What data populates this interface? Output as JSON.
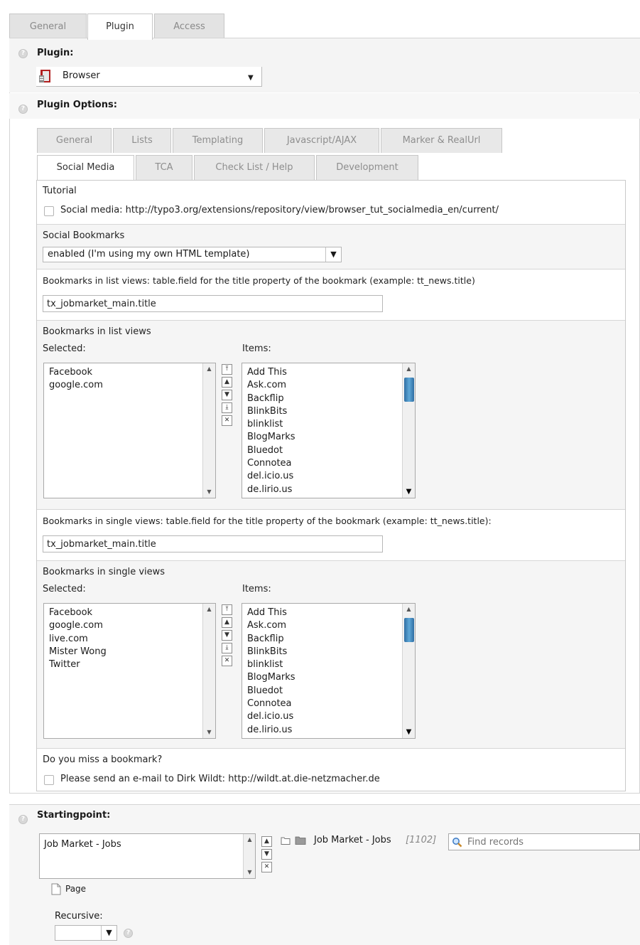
{
  "top_tabs": [
    "General",
    "Plugin",
    "Access"
  ],
  "plugin": {
    "title": "Plugin:",
    "selected": "Browser"
  },
  "plugin_options": {
    "title": "Plugin Options:",
    "tabs_row1": [
      "General",
      "Lists",
      "Templating",
      "Javascript/AJAX",
      "Marker & RealUrl"
    ],
    "tabs_row2": [
      "Social Media",
      "TCA",
      "Check List / Help",
      "Development"
    ]
  },
  "form": {
    "tutorial": {
      "label": "Tutorial",
      "checkbox_text": "Social media: http://typo3.org/extensions/repository/view/browser_tut_socialmedia_en/current/"
    },
    "social_bookmarks": {
      "label": "Social Bookmarks",
      "value": "enabled (I'm using my own HTML template)"
    },
    "list_title_field": {
      "label": "Bookmarks in list views: table.field for the title property of the bookmark (example: tt_news.title)",
      "value": "tx_jobmarket_main.title"
    },
    "list_views": {
      "label": "Bookmarks in list views",
      "selected_label": "Selected:",
      "items_label": "Items:",
      "selected": [
        "Facebook",
        "google.com"
      ],
      "items": [
        "Add This",
        "Ask.com",
        "Backflip",
        "BlinkBits",
        "blinklist",
        "BlogMarks",
        "Bluedot",
        "Connotea",
        "del.icio.us",
        "de.lirio.us"
      ]
    },
    "single_title_field": {
      "label": "Bookmarks in single views: table.field for the title property of the bookmark (example: tt_news.title):",
      "value": "tx_jobmarket_main.title"
    },
    "single_views": {
      "label": "Bookmarks in single views",
      "selected_label": "Selected:",
      "items_label": "Items:",
      "selected": [
        "Facebook",
        "google.com",
        "live.com",
        "Mister Wong",
        "Twitter"
      ],
      "items": [
        "Add This",
        "Ask.com",
        "Backflip",
        "BlinkBits",
        "blinklist",
        "BlogMarks",
        "Bluedot",
        "Connotea",
        "del.icio.us",
        "de.lirio.us"
      ]
    },
    "miss_bookmark": {
      "label": "Do you miss a bookmark?",
      "checkbox_text": "Please send an e-mail to Dirk Wildt: http://wildt.at.die-netzmacher.de"
    }
  },
  "startingpoint": {
    "title": "Startingpoint:",
    "selected": [
      "Job Market - Jobs"
    ],
    "record_title": "Job Market - Jobs",
    "record_id": "[1102]",
    "find_placeholder": "Find records",
    "page_label": "Page",
    "recursive_label": "Recursive:"
  }
}
